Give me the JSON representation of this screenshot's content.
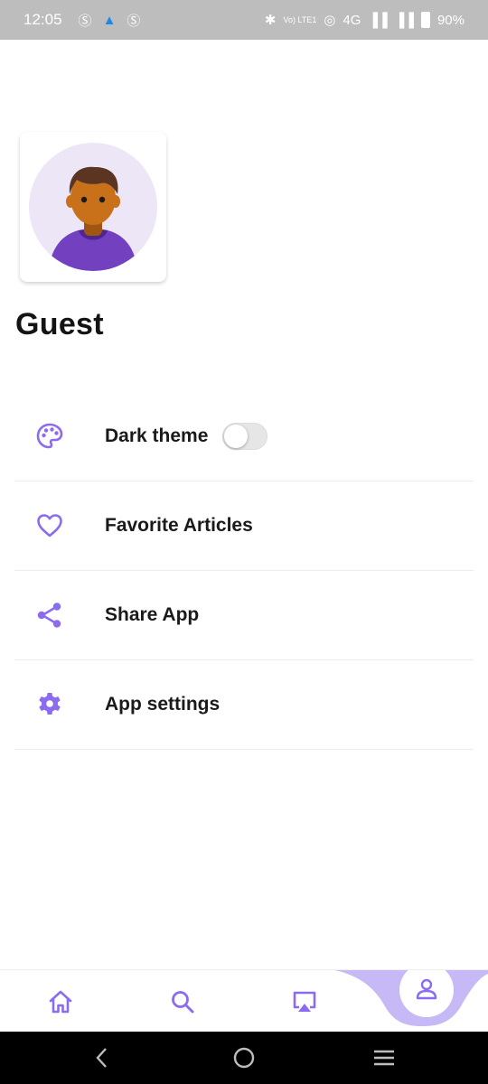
{
  "status_bar": {
    "time": "12:05",
    "network": "4G",
    "volte": "Vo) LTE1",
    "battery": "90%"
  },
  "profile": {
    "name": "Guest"
  },
  "menu": {
    "items": [
      {
        "label": "Dark theme",
        "icon": "palette-icon",
        "toggle": false
      },
      {
        "label": "Favorite Articles",
        "icon": "heart-icon"
      },
      {
        "label": "Share App",
        "icon": "share-icon"
      },
      {
        "label": "App settings",
        "icon": "gear-icon"
      }
    ]
  },
  "bottom_nav": {
    "items": [
      "home-icon",
      "search-icon",
      "airplay-icon",
      "profile-icon"
    ],
    "active": "profile-icon"
  },
  "colors": {
    "accent": "#8b6cf0",
    "accent_light": "#c7b8f6",
    "status_bar": "#bdbdbd",
    "avatar_bg": "#ece6f6"
  }
}
